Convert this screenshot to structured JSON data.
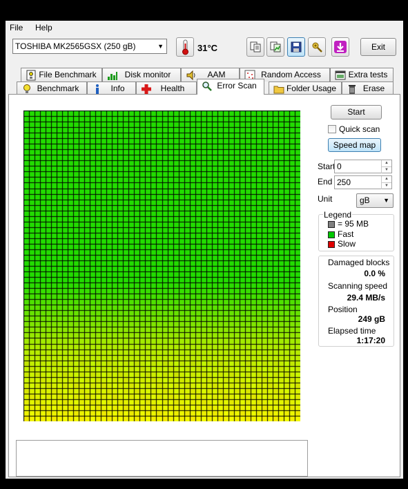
{
  "menu": {
    "file": "File",
    "help": "Help"
  },
  "drive": {
    "selected": "TOSHIBA MK2565GSX (250 gB)"
  },
  "temperature": "31°C",
  "toolbar": {
    "exit_label": "Exit"
  },
  "tabs_row1": [
    {
      "label": "File Benchmark",
      "icon": "file-benchmark-icon"
    },
    {
      "label": "Disk monitor",
      "icon": "disk-monitor-icon"
    },
    {
      "label": "AAM",
      "icon": "speaker-icon"
    },
    {
      "label": "Random Access",
      "icon": "random-access-icon"
    },
    {
      "label": "Extra tests",
      "icon": "extra-tests-icon"
    }
  ],
  "tabs_row2": [
    {
      "label": "Benchmark",
      "icon": "lightbulb-icon"
    },
    {
      "label": "Info",
      "icon": "info-icon"
    },
    {
      "label": "Health",
      "icon": "health-cross-icon"
    },
    {
      "label": "Error Scan",
      "icon": "magnifier-icon",
      "active": true
    },
    {
      "label": "Folder Usage",
      "icon": "folder-icon"
    },
    {
      "label": "Erase",
      "icon": "trash-icon"
    }
  ],
  "scan": {
    "start_button": "Start",
    "quick_scan_label": "Quick scan",
    "quick_scan_checked": false,
    "speed_map_button": "Speed map",
    "start_label": "Start",
    "start_value": "0",
    "end_label": "End",
    "end_value": "250",
    "unit_label": "Unit",
    "unit_value": "gB"
  },
  "legend": {
    "title": "Legend",
    "block_size": "= 95 MB",
    "fast": "Fast",
    "slow": "Slow",
    "colors": {
      "block": "#808080",
      "fast": "#00c800",
      "slow": "#e00000"
    }
  },
  "stats": {
    "damaged_label": "Damaged blocks",
    "damaged_value": "0.0 %",
    "speed_label": "Scanning speed",
    "speed_value": "29.4 MB/s",
    "position_label": "Position",
    "position_value": "249 gB",
    "elapsed_label": "Elapsed time",
    "elapsed_value": "1:17:20"
  },
  "speed_map": {
    "columns": 50,
    "rows": 56,
    "colors": {
      "fast": "#22dc00",
      "mid": "#b6ec00",
      "slow": "#f2f200",
      "grid": "#000000"
    }
  }
}
